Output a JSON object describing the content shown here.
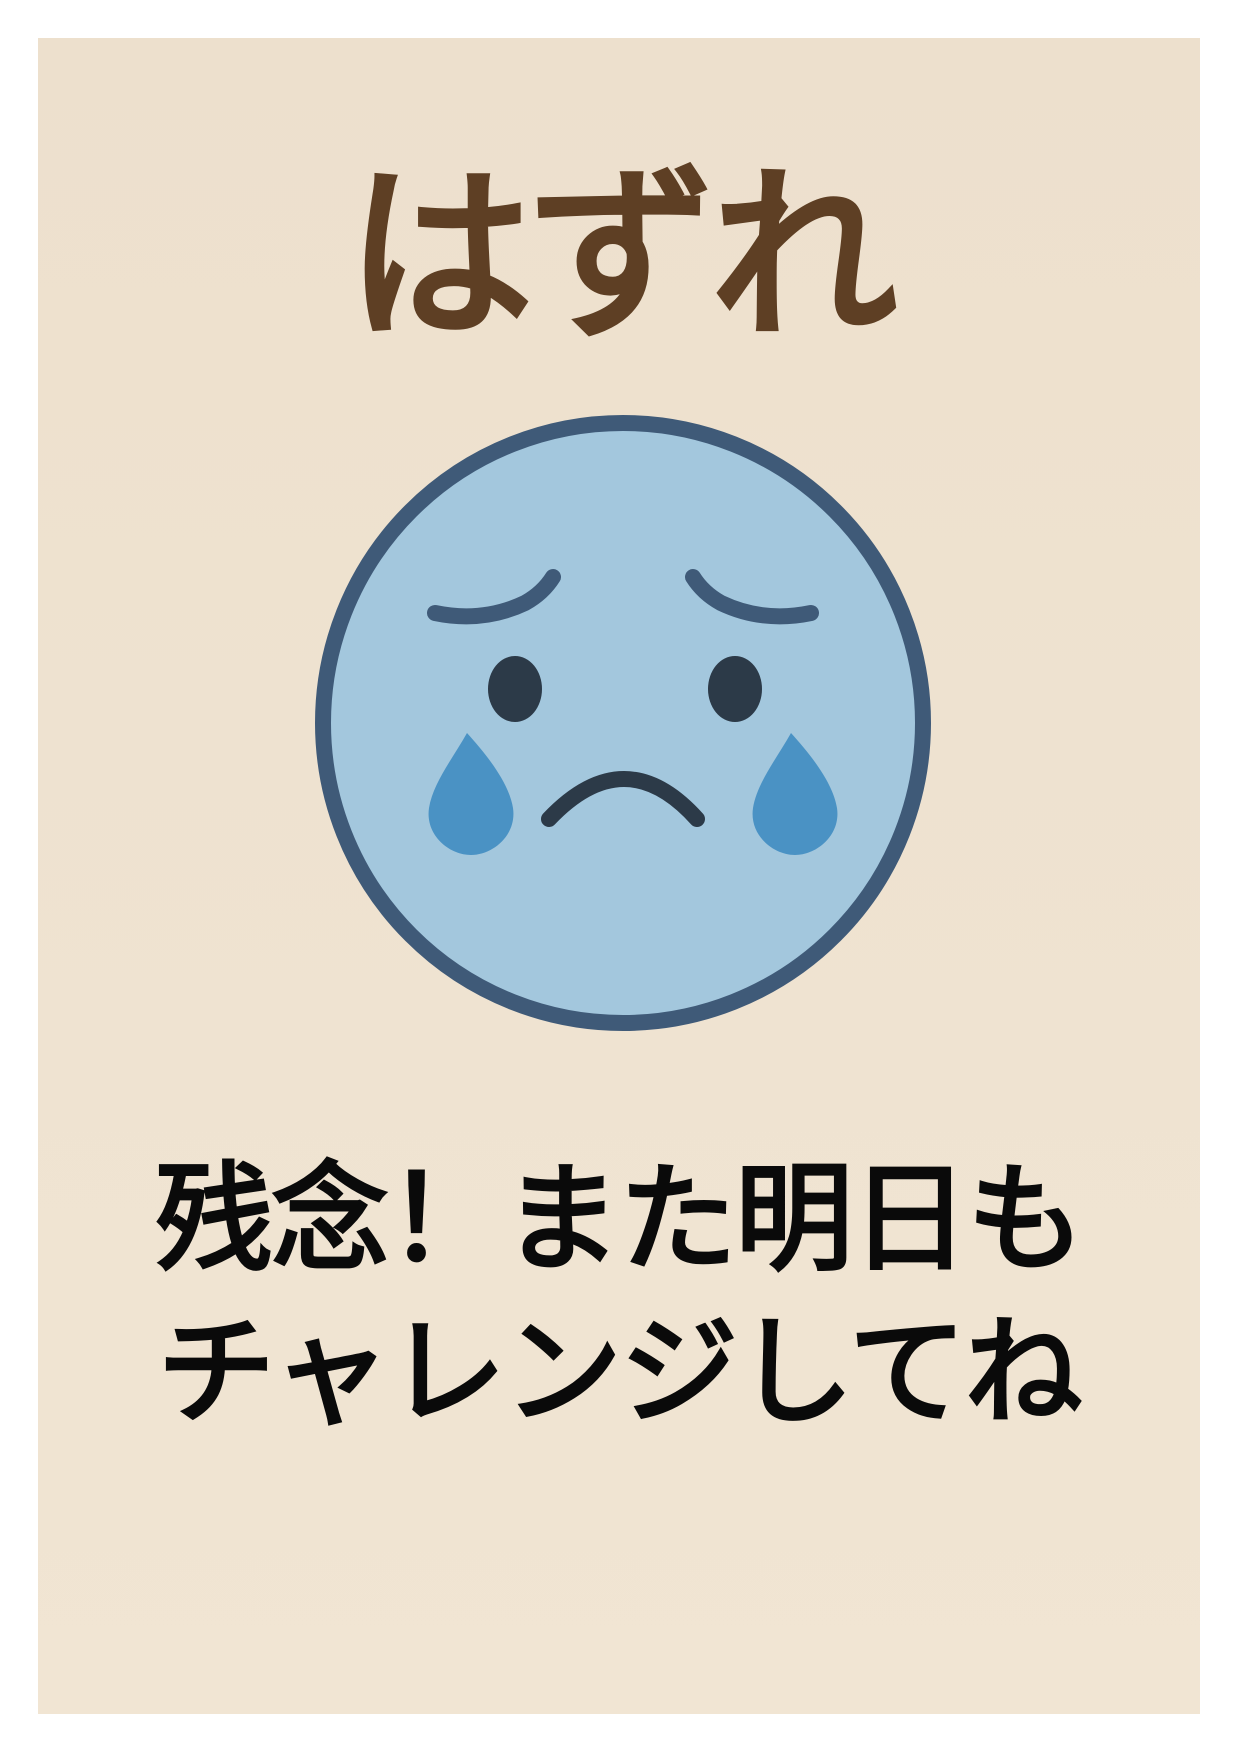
{
  "poster": {
    "title": "はずれ",
    "message_lines": [
      "残念！また明日も",
      "チャレンジしてね"
    ]
  },
  "illustration": {
    "name": "crying-sad-face-icon",
    "colors": {
      "face_fill": "#a3c7dd",
      "face_outline": "#3f5a78",
      "features": "#2c3a48",
      "tears": "#4a92c4"
    }
  },
  "colors": {
    "background": "#efe3d1",
    "title": "#5e3f24",
    "message": "#0a0a0a"
  }
}
